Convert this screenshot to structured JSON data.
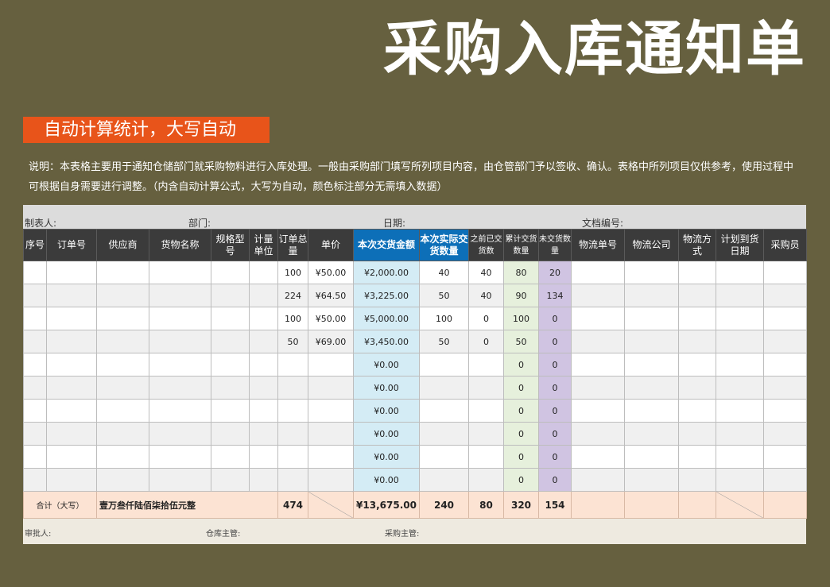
{
  "title": "采购入库通知单",
  "badge": "自动计算统计，大写自动",
  "description": "说明：本表格主要用于通知仓储部门就采购物料进行入库处理。一般由采购部门填写所列项目内容，由仓管部门予以签收、确认。表格中所列项目仅供参考，使用过程中可根据自身需要进行调整。（内含自动计算公式，大写为自动，颜色标注部分无需填入数据）",
  "meta": {
    "maker": "制表人:",
    "department": "部门:",
    "date": "日期:",
    "doc_no": "文档编号:"
  },
  "columns": [
    "序号",
    "订单号",
    "供应商",
    "货物名称",
    "规格型号",
    "计量单位",
    "订单总量",
    "单价",
    "本次交货金额",
    "本次实际交货数量",
    "之前已交货数",
    "累计交货数量",
    "未交货数量",
    "物流单号",
    "物流公司",
    "物流方式",
    "计划到货日期",
    "采购员"
  ],
  "rows": [
    {
      "qty": "100",
      "price": "¥50.00",
      "amount": "¥2,000.00",
      "actual": "40",
      "before": "40",
      "cum": "80",
      "remain": "20"
    },
    {
      "qty": "224",
      "price": "¥64.50",
      "amount": "¥3,225.00",
      "actual": "50",
      "before": "40",
      "cum": "90",
      "remain": "134"
    },
    {
      "qty": "100",
      "price": "¥50.00",
      "amount": "¥5,000.00",
      "actual": "100",
      "before": "0",
      "cum": "100",
      "remain": "0"
    },
    {
      "qty": "50",
      "price": "¥69.00",
      "amount": "¥3,450.00",
      "actual": "50",
      "before": "0",
      "cum": "50",
      "remain": "0"
    },
    {
      "qty": "",
      "price": "",
      "amount": "¥0.00",
      "actual": "",
      "before": "",
      "cum": "0",
      "remain": "0"
    },
    {
      "qty": "",
      "price": "",
      "amount": "¥0.00",
      "actual": "",
      "before": "",
      "cum": "0",
      "remain": "0"
    },
    {
      "qty": "",
      "price": "",
      "amount": "¥0.00",
      "actual": "",
      "before": "",
      "cum": "0",
      "remain": "0"
    },
    {
      "qty": "",
      "price": "",
      "amount": "¥0.00",
      "actual": "",
      "before": "",
      "cum": "0",
      "remain": "0"
    },
    {
      "qty": "",
      "price": "",
      "amount": "¥0.00",
      "actual": "",
      "before": "",
      "cum": "0",
      "remain": "0"
    },
    {
      "qty": "",
      "price": "",
      "amount": "¥0.00",
      "actual": "",
      "before": "",
      "cum": "0",
      "remain": "0"
    }
  ],
  "total": {
    "label": "合计（大写）",
    "words": "壹万叁仟陆佰柒拾伍元整",
    "qty": "474",
    "amount": "¥13,675.00",
    "actual": "240",
    "before": "80",
    "cum": "320",
    "remain": "154"
  },
  "sign": {
    "approver": "审批人:",
    "warehouse": "仓库主管:",
    "purchase": "采购主管:"
  },
  "colors": {
    "background": "#66603f",
    "badge": "#e8541a",
    "header": "#3b3b3b",
    "highlight_header": "#0d6fb8",
    "amount_cell": "#d4ecf5",
    "cumulative_cell": "#e6f0dc",
    "remaining_cell": "#d0c4e2",
    "total_row": "#fce3d3"
  }
}
